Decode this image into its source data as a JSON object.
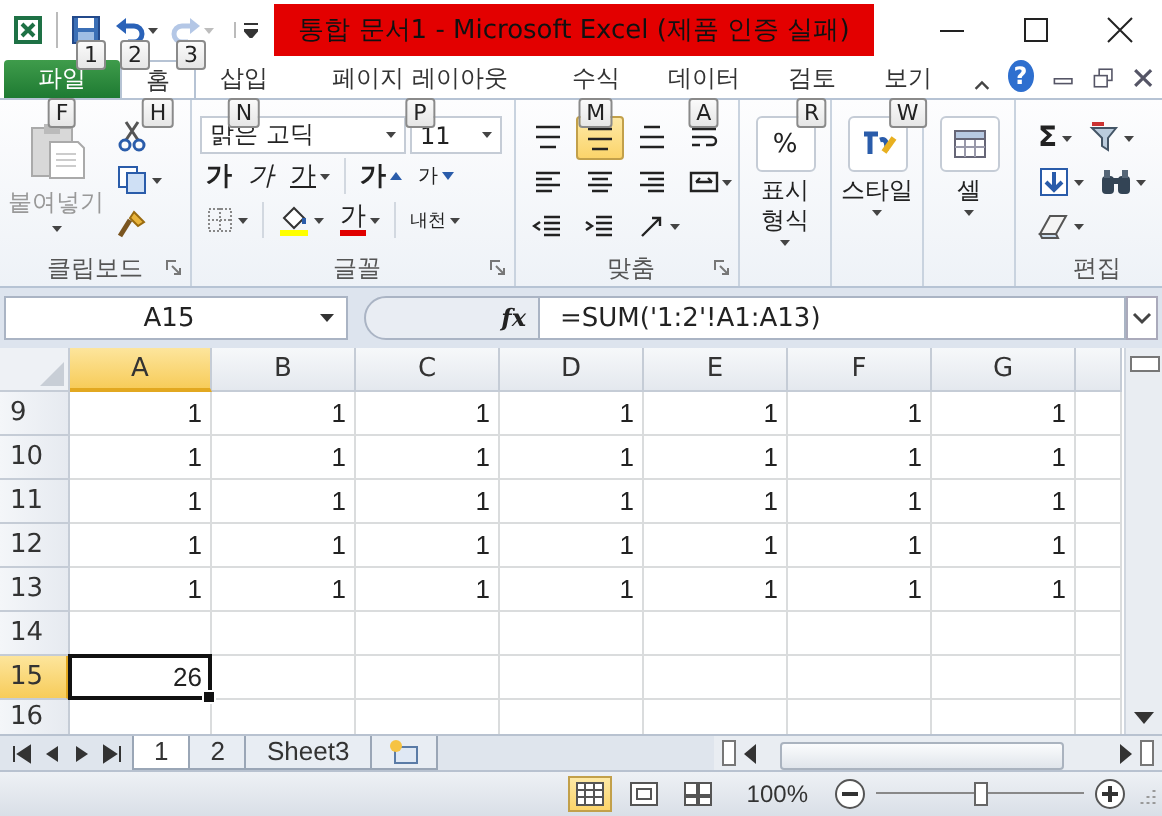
{
  "quick_access": [
    {
      "kind": "save",
      "keytip": "1",
      "disabled": false
    },
    {
      "kind": "undo",
      "keytip": "2",
      "disabled": false
    },
    {
      "kind": "redo",
      "keytip": "3",
      "disabled": true
    }
  ],
  "title": "통합 문서1  -  Microsoft Excel (제품 인증 실패)",
  "tabs": [
    {
      "label": "파일",
      "kind": "file",
      "keytip": "F",
      "selected": false
    },
    {
      "label": "홈",
      "kind": "tab",
      "keytip": "H",
      "selected": true
    },
    {
      "label": "삽입",
      "kind": "tab",
      "keytip": "N",
      "selected": false
    },
    {
      "label": "페이지 레이아웃",
      "kind": "tab",
      "keytip": "P",
      "selected": false
    },
    {
      "label": "수식",
      "kind": "tab",
      "keytip": "M",
      "selected": false
    },
    {
      "label": "데이터",
      "kind": "tab",
      "keytip": "A",
      "selected": false
    },
    {
      "label": "검토",
      "kind": "tab",
      "keytip": "R",
      "selected": false
    },
    {
      "label": "보기",
      "kind": "tab",
      "keytip": "W",
      "selected": false
    }
  ],
  "help": "?",
  "clipboard": {
    "label": "클립보드",
    "paste": {
      "label": "붙여넣기",
      "disabled": true
    }
  },
  "font": {
    "label": "글꼴",
    "name": "맑은 고딕",
    "size": "11",
    "bold": "가",
    "italic": "가",
    "underline": "가",
    "grow": "가",
    "shrink": "가",
    "font_color": "가",
    "phonetic": "내천"
  },
  "alignment": {
    "label": "맞춤",
    "rows": [
      [
        {
          "kind": "top",
          "selected": false
        },
        {
          "kind": "middle",
          "selected": true
        },
        {
          "kind": "bottom",
          "selected": false
        },
        {
          "kind": "wrap",
          "selected": false
        }
      ],
      [
        {
          "kind": "left",
          "selected": false
        },
        {
          "kind": "center",
          "selected": false
        },
        {
          "kind": "right",
          "selected": false
        },
        {
          "kind": "merge",
          "selected": false
        }
      ],
      [
        {
          "kind": "outdent",
          "selected": false
        },
        {
          "kind": "indent",
          "selected": false
        },
        {
          "kind": "orientation",
          "selected": false
        }
      ]
    ]
  },
  "collapsed_groups": [
    {
      "kind": "number",
      "label": "표시 형식",
      "icon_text": "%"
    },
    {
      "kind": "styles",
      "label": "스타일"
    },
    {
      "kind": "cells",
      "label": "셀"
    }
  ],
  "editing": {
    "label": "편집",
    "sum": "Σ"
  },
  "name_box": "A15",
  "fx": "fx",
  "formula": "=SUM('1:2'!A1:A13)",
  "columns": [
    {
      "label": "A",
      "selected": true
    },
    {
      "label": "B",
      "selected": false
    },
    {
      "label": "C",
      "selected": false
    },
    {
      "label": "D",
      "selected": false
    },
    {
      "label": "E",
      "selected": false
    },
    {
      "label": "F",
      "selected": false
    },
    {
      "label": "G",
      "selected": false
    }
  ],
  "rows": [
    {
      "header": "9",
      "selected": false,
      "cells": [
        "1",
        "1",
        "1",
        "1",
        "1",
        "1",
        "1"
      ]
    },
    {
      "header": "10",
      "selected": false,
      "cells": [
        "1",
        "1",
        "1",
        "1",
        "1",
        "1",
        "1"
      ]
    },
    {
      "header": "11",
      "selected": false,
      "cells": [
        "1",
        "1",
        "1",
        "1",
        "1",
        "1",
        "1"
      ]
    },
    {
      "header": "12",
      "selected": false,
      "cells": [
        "1",
        "1",
        "1",
        "1",
        "1",
        "1",
        "1"
      ]
    },
    {
      "header": "13",
      "selected": false,
      "cells": [
        "1",
        "1",
        "1",
        "1",
        "1",
        "1",
        "1"
      ]
    },
    {
      "header": "14",
      "selected": false,
      "cells": []
    },
    {
      "header": "15",
      "selected": true,
      "cells": [
        "26"
      ]
    },
    {
      "header": "16",
      "selected": false,
      "cells": []
    }
  ],
  "sheet_tabs": [
    {
      "label": "1",
      "selected": true
    },
    {
      "label": "2",
      "selected": false
    },
    {
      "label": "Sheet3",
      "selected": false
    }
  ],
  "views": [
    {
      "kind": "normal",
      "selected": true
    },
    {
      "kind": "page_layout",
      "selected": false
    },
    {
      "kind": "page_break",
      "selected": false
    }
  ],
  "zoom": "100%",
  "zoom_slider": {
    "level": 0.5
  }
}
